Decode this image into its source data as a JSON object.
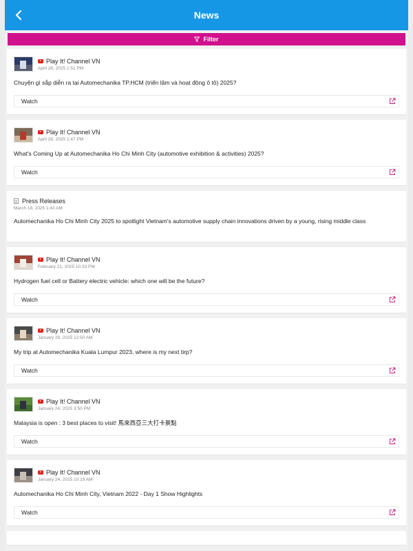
{
  "header": {
    "title": "News"
  },
  "filter": {
    "label": "Filter"
  },
  "colors": {
    "header_bg": "#1597e5",
    "filter_bg": "#d0108c",
    "youtube_red": "#e62117",
    "link_icon": "#c2187a"
  },
  "icons": {
    "back": "chevron-left-icon",
    "filter": "funnel-icon",
    "youtube": "youtube-icon",
    "external": "external-link-icon",
    "document": "document-icon"
  },
  "cards": [
    {
      "type": "video",
      "source": "Play It! Channel VN",
      "date": "April 28, 2025 1:51 PM",
      "title": "Chuyện gì sắp diễn ra tại Automechanika TP.HCM (triển lãm và hoạt động ô tô) 2025?",
      "action": "Watch"
    },
    {
      "type": "video",
      "source": "Play It! Channel VN",
      "date": "April 28, 2025 1:47 PM",
      "title": "What's Coming Up at Automechanika Ho Chi Minh City (automotive exhibition & activities) 2025?",
      "action": "Watch"
    },
    {
      "type": "press",
      "source": "Press Releases",
      "date": "March 18, 2025 1:43 AM",
      "title": "Automechanika Ho Chi Minh City 2025 to spotlight Vietnam's automotive supply chain innovations driven by a young, rising middle class"
    },
    {
      "type": "video",
      "source": "Play It! Channel VN",
      "date": "February 21, 2025 10:33 PM",
      "title": "Hydrogen fuel cell or Battery electric vehicle: which one will be the future?",
      "action": "Watch"
    },
    {
      "type": "video",
      "source": "Play It! Channel VN",
      "date": "January 28, 2025 12:50 AM",
      "title": "My trip at Automechanika Kuala Lumpur 2023, where is my next tirp?",
      "action": "Watch"
    },
    {
      "type": "video",
      "source": "Play It! Channel VN",
      "date": "January 24, 2025 3:50 PM",
      "title": "Malaysia is open : 3 best places to visit! 馬來西亞三大打卡景點",
      "action": "Watch"
    },
    {
      "type": "video",
      "source": "Play It! Channel VN",
      "date": "January 24, 2025 10:19 AM",
      "title": "Automechanika Ho Chi Minh City, Vietnam 2022 - Day 1 Show Highlights",
      "action": "Watch"
    }
  ]
}
